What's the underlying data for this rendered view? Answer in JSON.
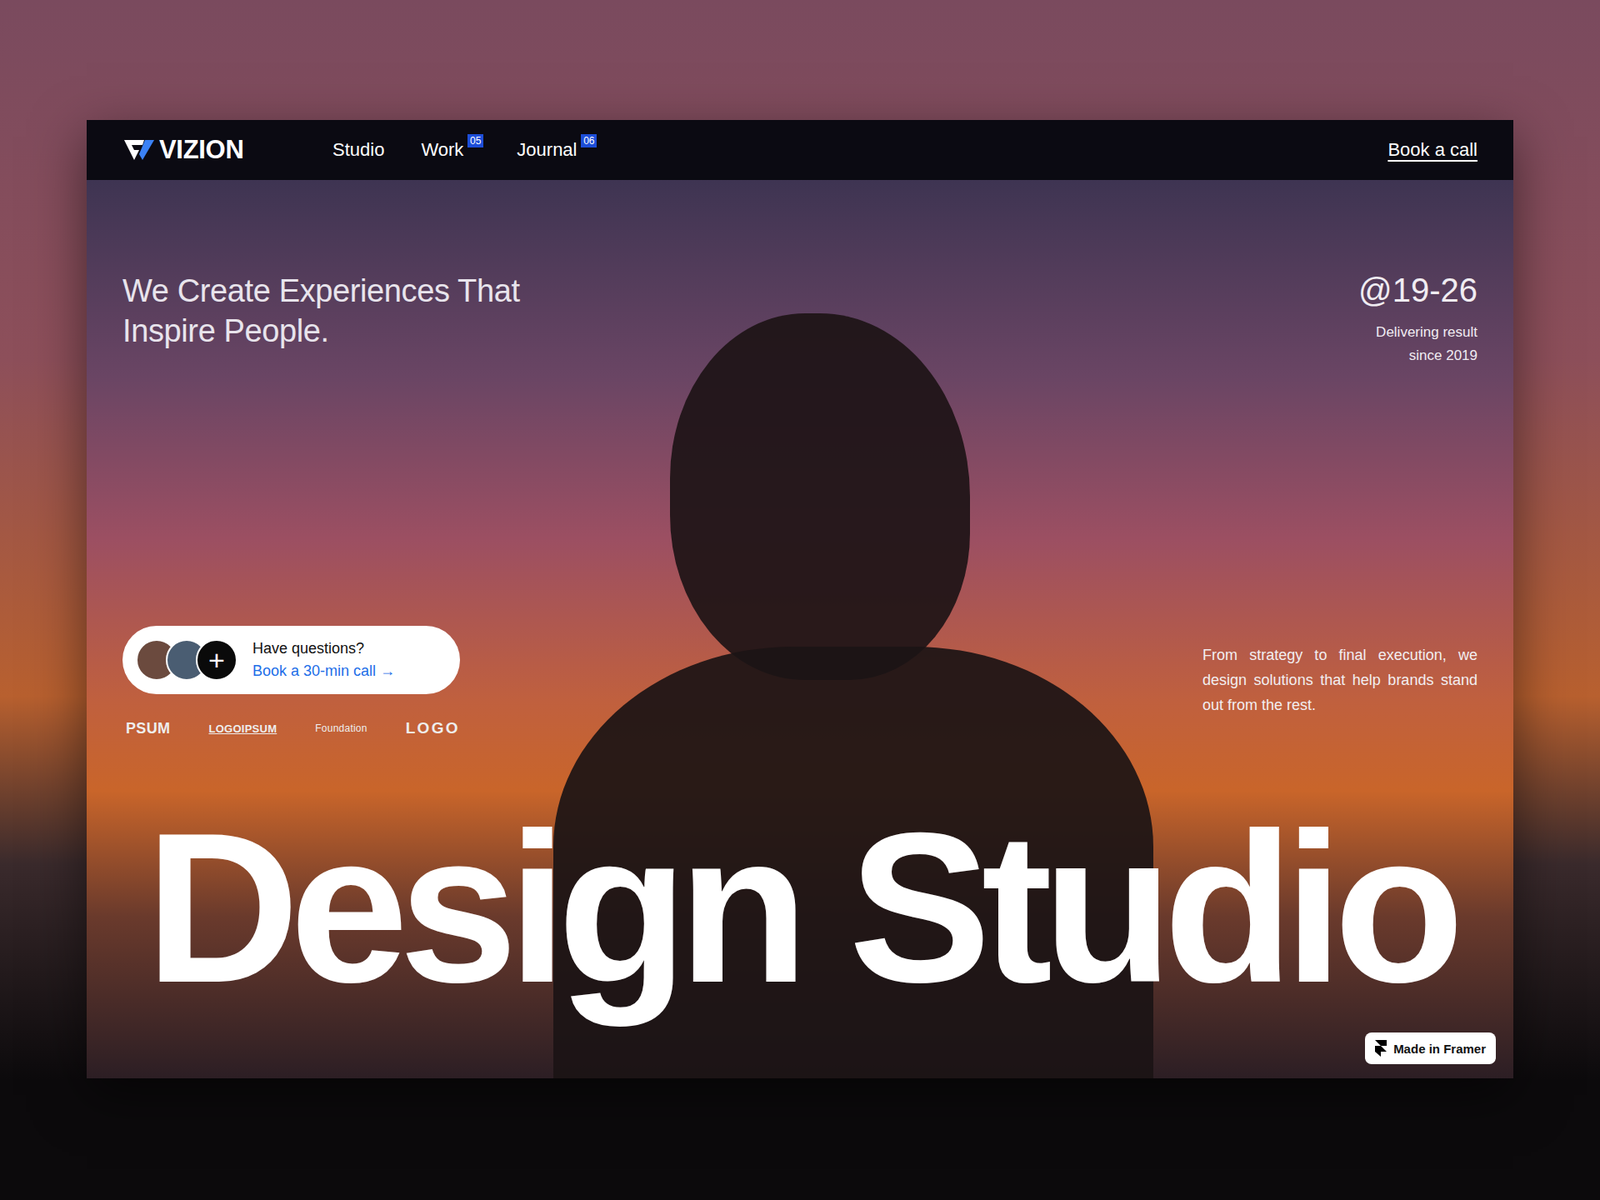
{
  "nav": {
    "logo": "VIZION",
    "links": [
      {
        "label": "Studio",
        "badge": ""
      },
      {
        "label": "Work",
        "badge": "05"
      },
      {
        "label": "Journal",
        "badge": "06"
      }
    ],
    "cta": "Book a call"
  },
  "hero": {
    "headline": "We Create Experiences That Inspire People.",
    "years": "@19-26",
    "since_lines": [
      "Delivering result",
      "since 2019"
    ],
    "contact": {
      "plus": "+",
      "question": "Have questions?",
      "link": "Book a 30-min call",
      "arrow": "→",
      "avatars": [
        {
          "color": "#6b4a3e"
        },
        {
          "color": "#4a5d72"
        }
      ]
    },
    "logos": [
      "PSUM",
      "LOGOIPSUM",
      "Foundation",
      "LOGO"
    ],
    "description": "From strategy to final execution, we design solutions that help brands stand out from the rest.",
    "title": "Design Studio"
  },
  "badge": {
    "label": "Made in Framer"
  }
}
